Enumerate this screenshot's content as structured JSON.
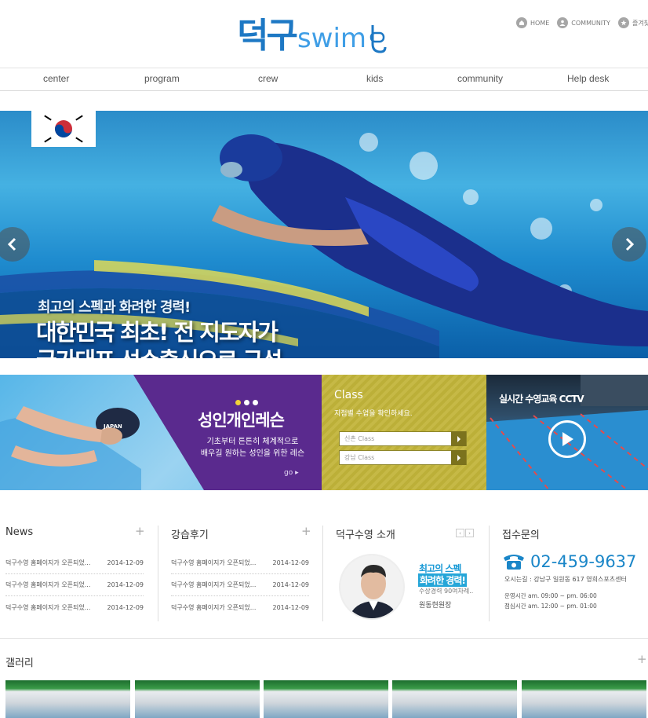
{
  "header": {
    "logo_ko": "덕구",
    "logo_en": "swim",
    "util": [
      {
        "label": "HOME",
        "icon": "home-icon"
      },
      {
        "label": "COMMUNITY",
        "icon": "user-icon"
      },
      {
        "label": "즐겨찾기",
        "icon": "star-icon"
      }
    ]
  },
  "nav": [
    {
      "label": "center"
    },
    {
      "label": "program"
    },
    {
      "label": "crew"
    },
    {
      "label": "kids"
    },
    {
      "label": "community"
    },
    {
      "label": "Help desk"
    }
  ],
  "hero": {
    "line1": "최고의 스펙과 화려한 경력!",
    "line2a": "대한민국 최초! 전 지도자가",
    "line2b": "국가대표 선수출신으로 구성"
  },
  "banners": {
    "lesson": {
      "title": "성인개인레슨",
      "desc1": "기초부터 튼튼히 체계적으로",
      "desc2": "배우길 원하는 성인을 위한 레슨",
      "go": "go ▸"
    },
    "class": {
      "title": "Class",
      "sub": "지점별 수업을 확인하세요.",
      "options": [
        "신촌 Class",
        "강남 Class"
      ]
    },
    "cctv": {
      "title": "실시간 수영교육 CCTV"
    }
  },
  "news": {
    "title": "News",
    "rows": [
      {
        "text": "덕구수영 홈페이지가 오픈되었...",
        "date": "2014-12-09"
      },
      {
        "text": "덕구수영 홈페이지가 오픈되었...",
        "date": "2014-12-09"
      },
      {
        "text": "덕구수영 홈페이지가 오픈되었...",
        "date": "2014-12-09"
      }
    ]
  },
  "reviews": {
    "title": "강습후기",
    "rows": [
      {
        "text": "덕구수영 홈페이지가 오픈되었...",
        "date": "2014-12-09"
      },
      {
        "text": "덕구수영 홈페이지가 오픈되었...",
        "date": "2014-12-09"
      },
      {
        "text": "덕구수영 홈페이지가 오픈되었...",
        "date": "2014-12-09"
      }
    ]
  },
  "intro": {
    "title": "덕구수영 소개",
    "t1": "최고의 스펙",
    "t2": "화려한 경력!",
    "t3": "수상경력 90여차례..",
    "t4": "원동현원장"
  },
  "contact": {
    "title": "접수문의",
    "phone": "02-459-9637",
    "address": "오시는길 : 강남구 일원동 617 영희스포츠센터",
    "hours1": "운영시간  am. 09:00 ~ pm. 06:00",
    "hours2": "점심시간  am. 12:00 ~ pm. 01:00"
  },
  "gallery": {
    "title": "갤러리"
  },
  "colors": {
    "brand_blue": "#1d78c4",
    "purple": "#5a2a8e",
    "olive": "#c2b53a",
    "phone_blue": "#1a86c8"
  }
}
